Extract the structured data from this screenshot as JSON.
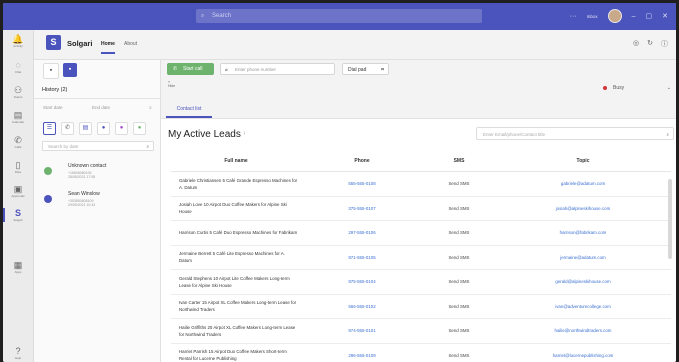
{
  "titlebar": {
    "search_placeholder": "Search",
    "user_status": "Inbox"
  },
  "rail": [
    {
      "icon": "bell-icon",
      "glyph": "🔔",
      "label": "Activity"
    },
    {
      "icon": "chat-icon",
      "glyph": "💬",
      "label": "Chat"
    },
    {
      "icon": "teams-icon",
      "glyph": "👥",
      "label": "Teams"
    },
    {
      "icon": "calendar-icon",
      "glyph": "📅",
      "label": "Calendar"
    },
    {
      "icon": "calls-icon",
      "glyph": "📞",
      "label": "Calls"
    },
    {
      "icon": "files-icon",
      "glyph": "📄",
      "label": "Files"
    },
    {
      "icon": "approvals-icon",
      "glyph": "📋",
      "label": "Approvals"
    },
    {
      "icon": "solgari-icon",
      "glyph": "S",
      "label": "Solgari"
    },
    {
      "icon": "apps-icon",
      "glyph": "▦",
      "label": "Apps"
    },
    {
      "icon": "help-icon",
      "glyph": "?",
      "label": "Help"
    }
  ],
  "app": {
    "logo": "S",
    "name": "Solgari",
    "tabs": [
      "Home",
      "About"
    ]
  },
  "history": {
    "title": "History (2)",
    "start_date": "Start date",
    "end_date": "End date",
    "search_placeholder": "Search by date",
    "items": [
      {
        "name": "Unknown contact",
        "line1": "+16506080109",
        "line2": "28/05/2021 17:55",
        "color": "#6db36e"
      },
      {
        "name": "Sean Winslow",
        "line1": "+353850808109",
        "line2": "29/05/2021 10:43",
        "color": "#4b53bc"
      }
    ]
  },
  "dialbar": {
    "start_call": "Start call",
    "phone_placeholder": "Enter phone number",
    "dial_pad": "Dial pad",
    "hide": "Hide",
    "status": "Busy"
  },
  "contacts": {
    "tab": "Contact list",
    "title": "My Active  Leads",
    "search_placeholder": "Enter Email/phone/Contact title",
    "columns": [
      "Full name",
      "Phone",
      "SMS",
      "Topic"
    ],
    "rows": [
      {
        "name": "Gabriele Christiansen 5 Café Grande Espresso Machines for A. Datum",
        "phone": "555-555-0108",
        "sms": "Send SMS",
        "topic": "gabriele@adatum.com"
      },
      {
        "name": "Josiah Love 10 Airpot Duo Coffee Makers for Alpine Ski House",
        "phone": "375-555-0107",
        "sms": "Send SMS",
        "topic": "josiah@alpineskihouse.com"
      },
      {
        "name": "Harrison Curtis 5 Café Duo Espresso Machines for Fabrikam",
        "phone": "297-555-0106",
        "sms": "Send SMS",
        "topic": "harrison@fabrikam.com"
      },
      {
        "name": "Jermaine Berrett 5 Café Lite Espresso Machines for A. Datum",
        "phone": "971-555-0105",
        "sms": "Send SMS",
        "topic": "jermaine@adatum.com"
      },
      {
        "name": "Gerald Stephens 10 Airpot Lite Coffee Makers Long-term Lease for Alpine Ski House",
        "phone": "975-555-0104",
        "sms": "Send SMS",
        "topic": "gerald@alpineskihouse.com"
      },
      {
        "name": "Ivan Carter 15 Airpot XL Coffee Makers Long-term Lease for Northwind Traders",
        "phone": "566-555-0102",
        "sms": "Send SMS",
        "topic": "ivan@adventurecollege.com"
      },
      {
        "name": "Hailie Griffiths 20 Airpot XL Coffee Makers Long-term Lease for Northwind Traders",
        "phone": "974-555-0101",
        "sms": "Send SMS",
        "topic": "hailie@northwindtraders.com"
      },
      {
        "name": "Harriet Parrish 15 Airpot Duo Coffee Makers Short-term Rental for Lucerne Publishing",
        "phone": "296-555-0109",
        "sms": "Send SMS",
        "topic": "harriet@lucernepublishing.com"
      }
    ]
  },
  "colors": {
    "brand": "#4b53bc",
    "call": "#6db36e",
    "busy": "#d13438",
    "link": "#3b6fd1"
  }
}
